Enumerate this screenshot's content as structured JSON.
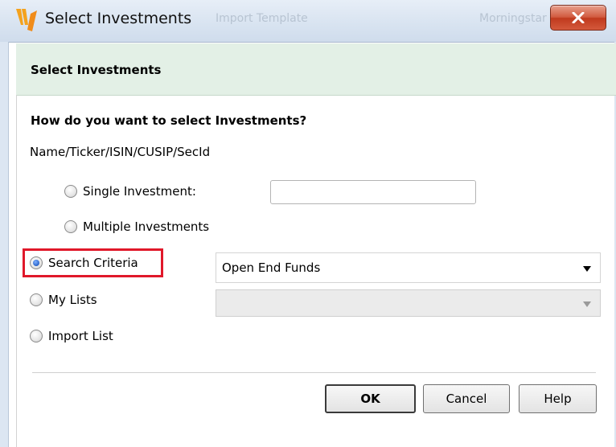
{
  "window": {
    "title": "Select Investments",
    "background_text_left": "Import Template",
    "background_text_right": "Morningstar"
  },
  "header": {
    "title": "Select Investments"
  },
  "form": {
    "question": "How do you want to select Investments?",
    "subtitle": "Name/Ticker/ISIN/CUSIP/SecId",
    "single_label": "Single Investment:",
    "single_value": "",
    "multiple_label": "Multiple Investments",
    "search_label": "Search Criteria",
    "search_value": "Open End Funds",
    "lists_label": "My Lists",
    "lists_value": "",
    "import_label": "Import List",
    "selected_option": "Search Criteria"
  },
  "buttons": {
    "ok": "OK",
    "cancel": "Cancel",
    "help": "Help"
  },
  "colors": {
    "header_band": "#e3f0e6",
    "highlight": "#e0182a",
    "close_button": "#c8432a"
  },
  "icons": {
    "app": "morningstar-logo-icon",
    "close": "close-icon",
    "dropdown": "chevron-down-icon"
  }
}
